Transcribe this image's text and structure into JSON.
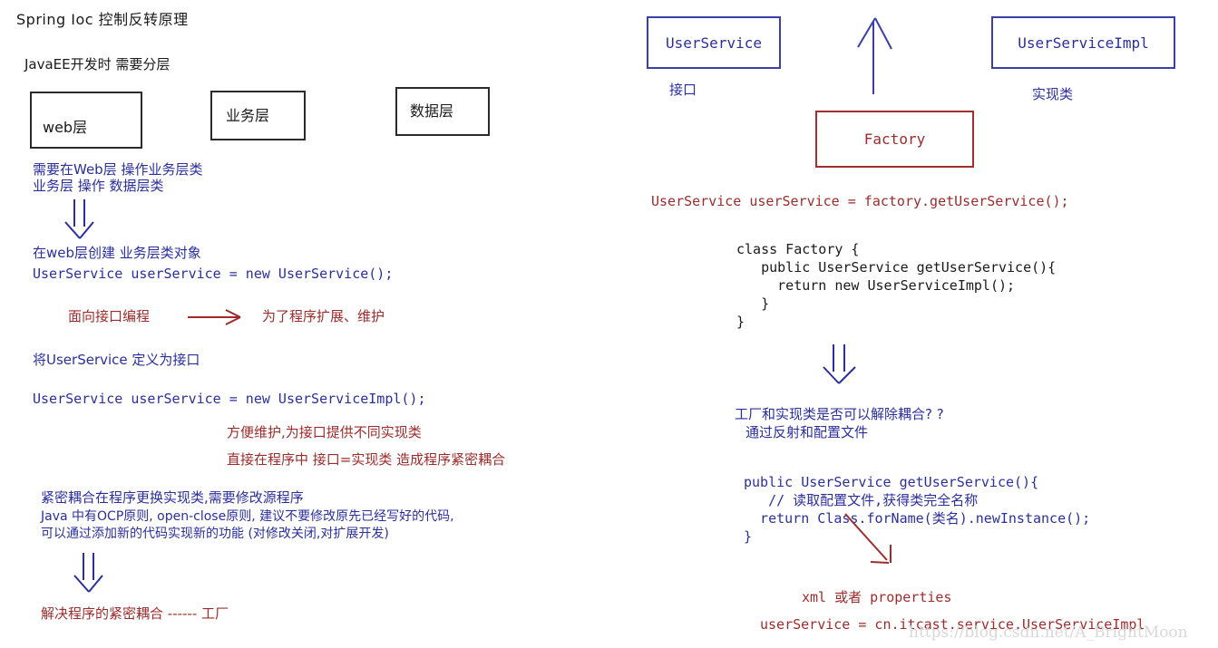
{
  "meta": {
    "watermark": "https://blog.csdn.net/A_BrightMoon"
  },
  "left": {
    "title": "Spring Ioc 控制反转原理",
    "subtitle": "JavaEE开发时 需要分层",
    "layer_boxes": [
      {
        "label": "web层"
      },
      {
        "label": "业务层"
      },
      {
        "label": "数据层"
      }
    ],
    "note1_line1": "需要在Web层 操作业务层类",
    "note1_line2": "业务层 操作 数据层类",
    "note2_line1": "在web层创建 业务层类对象",
    "note2_line2": "UserService userService = new UserService();",
    "red_arrow_left": "面向接口编程",
    "red_arrow_glyph": "——>",
    "red_arrow_right": "为了程序扩展、维护",
    "note3": "将UserService 定义为接口",
    "note4": "UserService userService = new UserServiceImpl();",
    "red_block_line1": "方便维护,为接口提供不同实现类",
    "red_block_line2": "直接在程序中 接口=实现类 造成程序紧密耦合",
    "note5_line1": "紧密耦合在程序更换实现类,需要修改源程序",
    "note5_line2": "Java 中有OCP原则, open-close原则, 建议不要修改原先已经写好的代码,",
    "note5_line3": "可以通过添加新的代码实现新的功能 (对修改关闭,对扩展开发)",
    "conclusion": "解决程序的紧密耦合 ------ 工厂"
  },
  "right": {
    "interface_box": "UserService",
    "interface_caption": "接口",
    "impl_box": "UserServiceImpl",
    "impl_caption": "实现类",
    "factory_box": "Factory",
    "factory_call": "UserService userService = factory.getUserService();",
    "factory_code": [
      "class Factory {",
      "   public UserService getUserService(){",
      "     return new UserServiceImpl();",
      "   }",
      "}"
    ],
    "question_line1": "工厂和实现类是否可以解除耦合? ?",
    "question_line2": "通过反射和配置文件",
    "reflect_code": [
      "public UserService getUserService(){",
      "   // 读取配置文件,获得类完全名称",
      "  return Class.forName(类名).newInstance();",
      "}"
    ],
    "config_label": "xml 或者 properties",
    "config_value": "userService = cn.itcast.service.UserServiceImpl"
  },
  "colors": {
    "black": "#1a1a1a",
    "blue": "#2b2f9e",
    "red": "#9e2b2b",
    "box_black": "#2b2b2b",
    "box_blue": "#3b3fa8",
    "box_red": "#a03030"
  }
}
